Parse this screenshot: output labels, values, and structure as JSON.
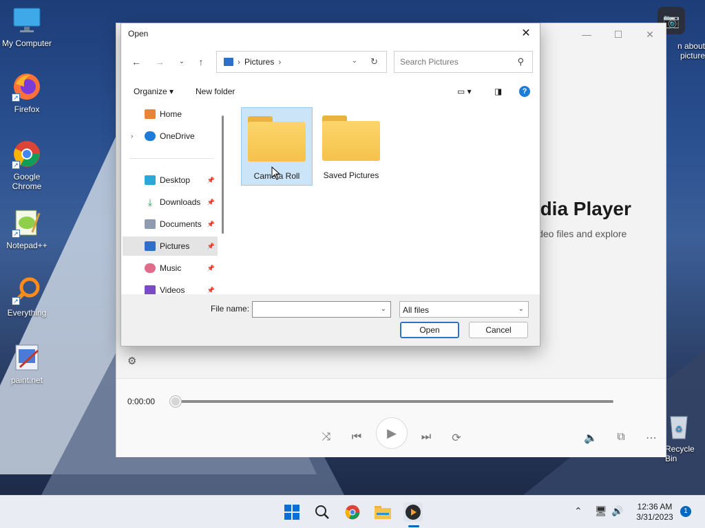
{
  "desktop": {
    "icons": [
      {
        "label": "My Computer"
      },
      {
        "label": "Firefox"
      },
      {
        "label": "Google Chrome"
      },
      {
        "label": "Notepad++"
      },
      {
        "label": "Everything"
      },
      {
        "label": "paint.net"
      },
      {
        "label": "Recycle Bin"
      }
    ]
  },
  "media_player": {
    "heading": "edia Player",
    "subtext": "video files and explore",
    "time": "0:00:00",
    "camera_text_line1": "n about",
    "camera_text_line2": "picture"
  },
  "dialog": {
    "title": "Open",
    "address": {
      "location": "Pictures"
    },
    "search_placeholder": "Search Pictures",
    "toolbar": {
      "organize": "Organize",
      "new_folder": "New folder"
    },
    "sidebar": {
      "items": [
        {
          "label": "Home"
        },
        {
          "label": "OneDrive"
        },
        {
          "label": "Desktop"
        },
        {
          "label": "Downloads"
        },
        {
          "label": "Documents"
        },
        {
          "label": "Pictures"
        },
        {
          "label": "Music"
        },
        {
          "label": "Videos"
        }
      ]
    },
    "folders": [
      {
        "label": "Camera Roll"
      },
      {
        "label": "Saved Pictures"
      }
    ],
    "footer": {
      "file_name_label": "File name:",
      "file_name_value": "",
      "filter": "All files",
      "open_label": "Open",
      "cancel_label": "Cancel"
    }
  },
  "taskbar": {
    "time": "12:36 AM",
    "date": "3/31/2023",
    "notification_count": "1"
  },
  "colors": {
    "accent": "#0067c0",
    "folder": "#f5c24a",
    "selection": "#cce4f7"
  }
}
